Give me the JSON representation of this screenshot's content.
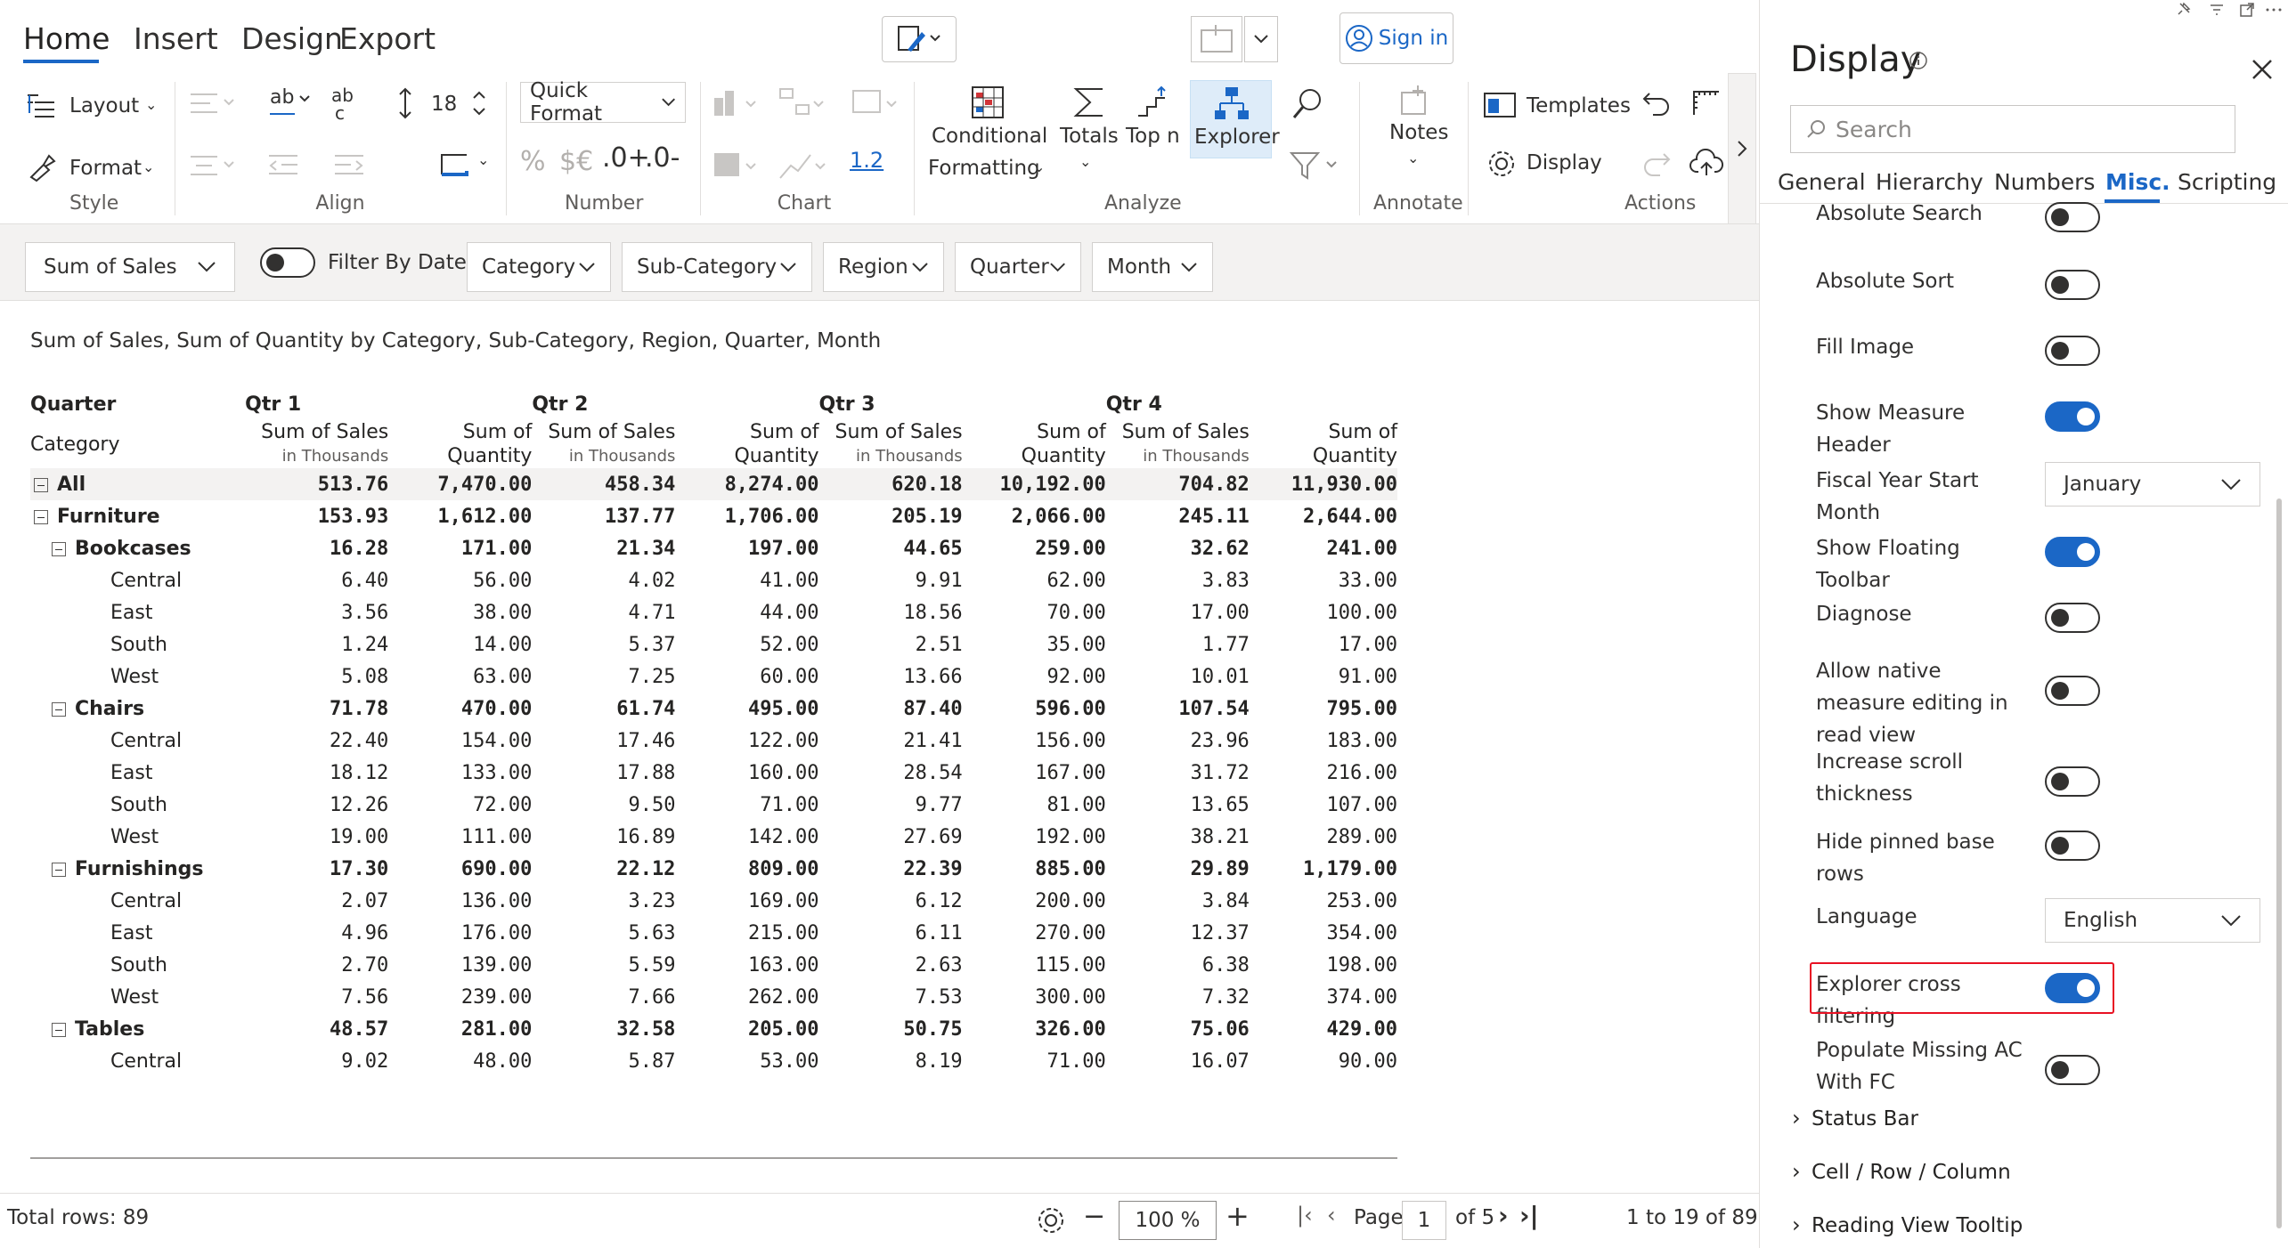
{
  "ribbon": {
    "tabs": [
      "Home",
      "Insert",
      "Design",
      "Export"
    ],
    "active_tab": "Home",
    "sign_in": "Sign in",
    "layout": "Layout",
    "format": "Format",
    "style_group": "Style",
    "align_group": "Align",
    "font_size": "18",
    "quick_format": "Quick Format",
    "number_group": "Number",
    "percent_symbol": "%",
    "currency_symbol": "$€",
    "decimal_increase": ".0+",
    "decimal_decrease": ".0-",
    "number_precision": "1.2",
    "chart_group": "Chart",
    "conditional_formatting_1": "Conditional",
    "conditional_formatting_2": "Formatting",
    "totals": "Totals",
    "top_n": "Top n",
    "explorer": "Explorer",
    "analyze_group": "Analyze",
    "notes": "Notes",
    "annotate_group": "Annotate",
    "templates": "Templates",
    "display": "Display",
    "actions_group": "Actions"
  },
  "filters": {
    "measure": "Sum of Sales",
    "filter_by_date": "Filter By Date",
    "dropdowns": [
      "Category",
      "Sub-Category",
      "Region",
      "Quarter",
      "Month"
    ]
  },
  "report": {
    "subtitle": "Sum of Sales, Sum of Quantity by Category, Sub-Category, Region, Quarter, Month",
    "corner_top": "Quarter",
    "corner_bottom": "Category",
    "quarters": [
      "Qtr 1",
      "Qtr 2",
      "Qtr 3",
      "Qtr 4"
    ],
    "measure_sales": "Sum of Sales",
    "measure_sales_unit": "in Thousands",
    "measure_qty_1": "Sum of",
    "measure_qty_2": "Quantity",
    "rows": [
      {
        "label": "All",
        "level": 0,
        "expander": true,
        "bold": true,
        "total": true,
        "values": [
          "513.76",
          "7,470.00",
          "458.34",
          "8,274.00",
          "620.18",
          "10,192.00",
          "704.82",
          "11,930.00"
        ]
      },
      {
        "label": "Furniture",
        "level": 0,
        "expander": true,
        "bold": true,
        "values": [
          "153.93",
          "1,612.00",
          "137.77",
          "1,706.00",
          "205.19",
          "2,066.00",
          "245.11",
          "2,644.00"
        ]
      },
      {
        "label": "Bookcases",
        "level": 1,
        "expander": true,
        "bold": true,
        "values": [
          "16.28",
          "171.00",
          "21.34",
          "197.00",
          "44.65",
          "259.00",
          "32.62",
          "241.00"
        ]
      },
      {
        "label": "Central",
        "level": 2,
        "values": [
          "6.40",
          "56.00",
          "4.02",
          "41.00",
          "9.91",
          "62.00",
          "3.83",
          "33.00"
        ]
      },
      {
        "label": "East",
        "level": 2,
        "values": [
          "3.56",
          "38.00",
          "4.71",
          "44.00",
          "18.56",
          "70.00",
          "17.00",
          "100.00"
        ]
      },
      {
        "label": "South",
        "level": 2,
        "values": [
          "1.24",
          "14.00",
          "5.37",
          "52.00",
          "2.51",
          "35.00",
          "1.77",
          "17.00"
        ]
      },
      {
        "label": "West",
        "level": 2,
        "values": [
          "5.08",
          "63.00",
          "7.25",
          "60.00",
          "13.66",
          "92.00",
          "10.01",
          "91.00"
        ]
      },
      {
        "label": "Chairs",
        "level": 1,
        "expander": true,
        "bold": true,
        "values": [
          "71.78",
          "470.00",
          "61.74",
          "495.00",
          "87.40",
          "596.00",
          "107.54",
          "795.00"
        ]
      },
      {
        "label": "Central",
        "level": 2,
        "values": [
          "22.40",
          "154.00",
          "17.46",
          "122.00",
          "21.41",
          "156.00",
          "23.96",
          "183.00"
        ]
      },
      {
        "label": "East",
        "level": 2,
        "values": [
          "18.12",
          "133.00",
          "17.88",
          "160.00",
          "28.54",
          "167.00",
          "31.72",
          "216.00"
        ]
      },
      {
        "label": "South",
        "level": 2,
        "values": [
          "12.26",
          "72.00",
          "9.50",
          "71.00",
          "9.77",
          "81.00",
          "13.65",
          "107.00"
        ]
      },
      {
        "label": "West",
        "level": 2,
        "values": [
          "19.00",
          "111.00",
          "16.89",
          "142.00",
          "27.69",
          "192.00",
          "38.21",
          "289.00"
        ]
      },
      {
        "label": "Furnishings",
        "level": 1,
        "expander": true,
        "bold": true,
        "values": [
          "17.30",
          "690.00",
          "22.12",
          "809.00",
          "22.39",
          "885.00",
          "29.89",
          "1,179.00"
        ]
      },
      {
        "label": "Central",
        "level": 2,
        "values": [
          "2.07",
          "136.00",
          "3.23",
          "169.00",
          "6.12",
          "200.00",
          "3.84",
          "253.00"
        ]
      },
      {
        "label": "East",
        "level": 2,
        "values": [
          "4.96",
          "176.00",
          "5.63",
          "215.00",
          "6.11",
          "270.00",
          "12.37",
          "354.00"
        ]
      },
      {
        "label": "South",
        "level": 2,
        "values": [
          "2.70",
          "139.00",
          "5.59",
          "163.00",
          "2.63",
          "115.00",
          "6.38",
          "198.00"
        ]
      },
      {
        "label": "West",
        "level": 2,
        "values": [
          "7.56",
          "239.00",
          "7.66",
          "262.00",
          "7.53",
          "300.00",
          "7.32",
          "374.00"
        ]
      },
      {
        "label": "Tables",
        "level": 1,
        "expander": true,
        "bold": true,
        "values": [
          "48.57",
          "281.00",
          "32.58",
          "205.00",
          "50.75",
          "326.00",
          "75.06",
          "429.00"
        ]
      },
      {
        "label": "Central",
        "level": 2,
        "values": [
          "9.02",
          "48.00",
          "5.87",
          "53.00",
          "8.19",
          "71.00",
          "16.07",
          "90.00"
        ]
      }
    ]
  },
  "status": {
    "total_rows": "Total rows: 89",
    "zoom": "100 %",
    "page_label": "Page",
    "page_number": "1",
    "page_of": "of 5",
    "range": "1 to 19 of 89"
  },
  "panel": {
    "title": "Display",
    "search_placeholder": "Search",
    "tabs": [
      "General",
      "Hierarchy",
      "Numbers",
      "Misc.",
      "Scripting"
    ],
    "active_tab": "Misc.",
    "settings": [
      {
        "label": "Absolute Search",
        "type": "toggle",
        "on": false
      },
      {
        "label": "Absolute Sort",
        "type": "toggle",
        "on": false
      },
      {
        "label": "Fill Image",
        "type": "toggle",
        "on": false
      },
      {
        "label": "Show Measure Header",
        "type": "toggle",
        "on": true
      },
      {
        "label": "Fiscal Year Start Month",
        "type": "dropdown",
        "value": "January"
      },
      {
        "label": "Show Floating Toolbar",
        "type": "toggle",
        "on": true
      },
      {
        "label": "Diagnose",
        "type": "toggle",
        "on": false
      },
      {
        "label": "Allow native measure editing in read view",
        "type": "toggle",
        "on": false
      },
      {
        "label": "Increase scroll thickness",
        "type": "toggle",
        "on": false
      },
      {
        "label": "Hide pinned base rows",
        "type": "toggle",
        "on": false
      },
      {
        "label": "Language",
        "type": "dropdown",
        "value": "English"
      },
      {
        "label": "Explorer cross filtering",
        "type": "toggle",
        "on": true,
        "highlighted": true
      },
      {
        "label": "Populate Missing AC With FC",
        "type": "toggle",
        "on": false
      }
    ],
    "sections": [
      "Status Bar",
      "Cell / Row / Column",
      "Reading View Tooltip"
    ],
    "accent": "#1b67c6",
    "highlight": "#e81123"
  }
}
